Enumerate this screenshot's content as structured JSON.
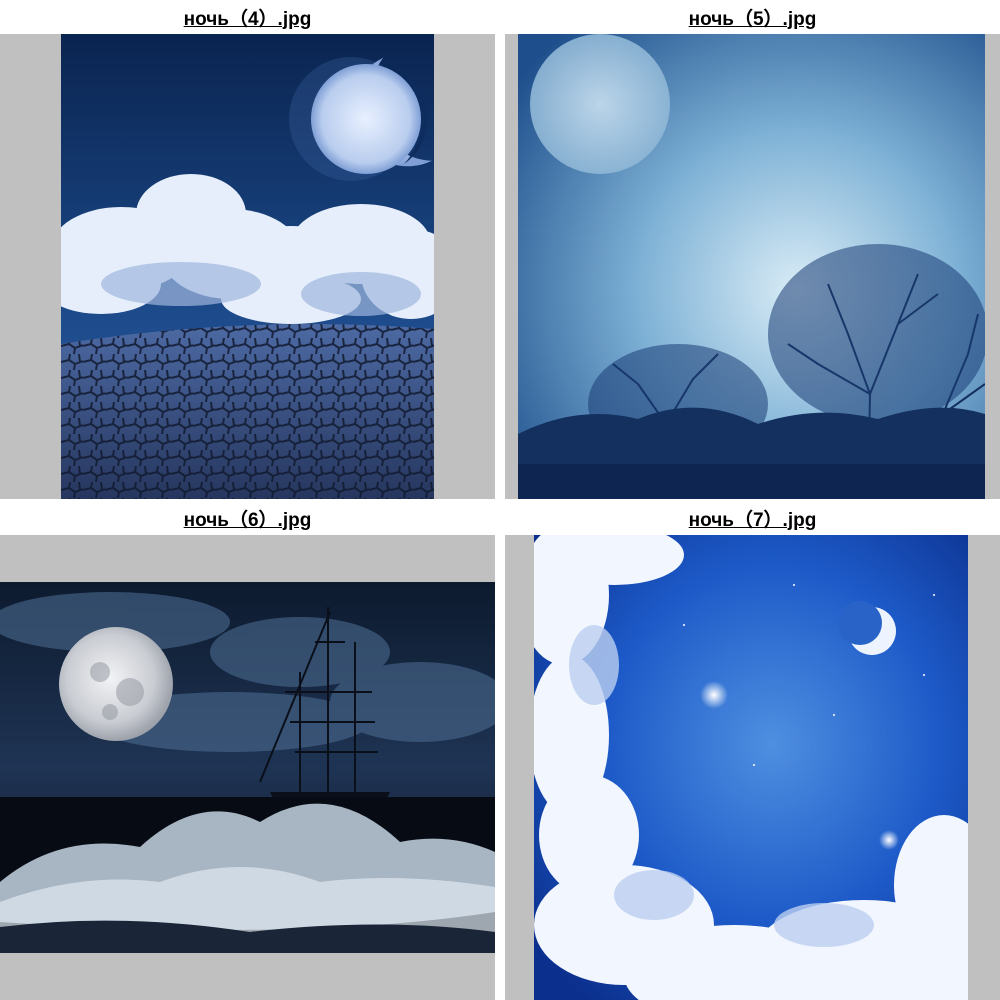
{
  "thumbnails": [
    {
      "title": "ночь（4）.jpg",
      "description_icon": "moon-clouds-cracked-earth"
    },
    {
      "title": "ночь（5）.jpg",
      "description_icon": "moon-bare-trees-texture"
    },
    {
      "title": "ночь（6）.jpg",
      "description_icon": "full-moon-ship-waves"
    },
    {
      "title": "ночь（7）.jpg",
      "description_icon": "crescent-moon-cloud-ring"
    }
  ],
  "colors": {
    "frame": "#c0c0c0",
    "background": "#ffffff",
    "title": "#000000"
  }
}
